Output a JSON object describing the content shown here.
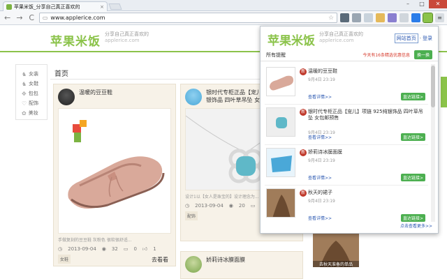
{
  "browser": {
    "tab_title": "苹果米饭_分享自己真正喜欢的",
    "tab_close": "×",
    "nav_back": "←",
    "nav_forward": "→",
    "nav_reload": "C",
    "url": "www.applerice.com",
    "star": "☆",
    "win_min": "–",
    "win_max": "□",
    "win_close": "✕"
  },
  "site": {
    "logo": "苹果米饭",
    "tagline": "分享自己真正喜欢的",
    "domain": "applerice.com",
    "section_title": "首页",
    "leftnav": [
      {
        "icon": "♞",
        "label": "女装"
      },
      {
        "icon": "♞",
        "label": "女鞋"
      },
      {
        "icon": "✥",
        "label": "包包"
      },
      {
        "icon": "♡",
        "label": "配饰"
      },
      {
        "icon": "✿",
        "label": "美妆"
      }
    ]
  },
  "cards": [
    {
      "name": "温暖的豆豆鞋",
      "desc": "手做复刻的豆豆鞋 灰粉色 很软很舒适...",
      "date": "2013-09-04",
      "views": "32",
      "comments": "0",
      "likes": "1",
      "tag": "女鞋",
      "more": "去看看"
    },
    {
      "name": "银时代专柜正品【宠儿】项链 925纯银饰品 四叶草吊坠 女包邮",
      "desc": "设计1以【女人是珠宝的】设计理念为...",
      "date": "2013-09-04",
      "views": "20",
      "comments": "0",
      "likes": "0",
      "tag": "配饰"
    },
    {
      "name": "娇莉诗冰膜面膜"
    }
  ],
  "popup": {
    "logo": "苹果米饭",
    "tagline": "分享自己真正喜欢的",
    "domain": "applerice.com",
    "home_link": "网站首页",
    "login_link": "登录",
    "all_label": "所有提醒",
    "count_text": "今天有16条精选优惠信息",
    "refresh_btn": "换一换",
    "items": [
      {
        "title": "温暖的豆豆鞋",
        "date": "9月4日 23:19",
        "view": "查看详情>>",
        "go": "直达链接>"
      },
      {
        "title": "银时代专柜正品【宠儿】项链 925纯银饰品 四叶草吊坠 女包邮预售",
        "date": "9月4日 23:19",
        "view": "查看详情>>",
        "go": "直达链接>"
      },
      {
        "title": "娇莉诗冰膜面膜",
        "date": "9月4日 23:19",
        "view": "查看详情>>",
        "go": "直达链接>"
      },
      {
        "title": "秋天的裙子",
        "date": "9月4日 23:19",
        "view": "查看详情>>",
        "go": "直达链接>"
      }
    ],
    "new_badge": "新",
    "footer": "点击查看更多>>"
  },
  "right_card": {
    "caption": "去秋天准备的单品"
  }
}
